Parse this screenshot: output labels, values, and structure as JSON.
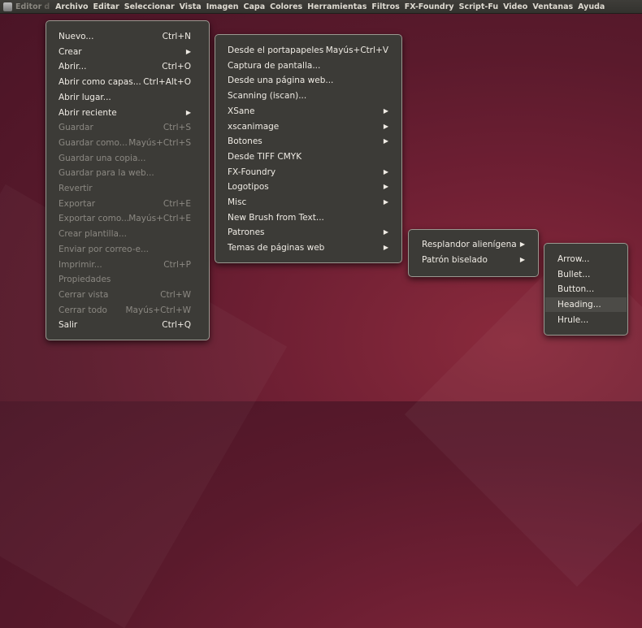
{
  "menubar": {
    "app_title": "Editor",
    "sep": "d",
    "items": [
      "Archivo",
      "Editar",
      "Seleccionar",
      "Vista",
      "Imagen",
      "Capa",
      "Colores",
      "Herramientas",
      "Filtros",
      "FX-Foundry",
      "Script-Fu",
      "Video",
      "Ventanas",
      "Ayuda"
    ]
  },
  "archivo_menu": [
    {
      "label": "Nuevo...",
      "acc": "Ctrl+N",
      "enabled": true
    },
    {
      "label": "Crear",
      "acc": "",
      "submenu": true,
      "enabled": true
    },
    {
      "label": "Abrir...",
      "acc": "Ctrl+O",
      "enabled": true
    },
    {
      "label": "Abrir como capas...",
      "acc": "Ctrl+Alt+O",
      "enabled": true
    },
    {
      "label": "Abrir lugar...",
      "acc": "",
      "enabled": true
    },
    {
      "label": "Abrir reciente",
      "acc": "",
      "submenu": true,
      "enabled": true
    },
    {
      "label": "Guardar",
      "acc": "Ctrl+S",
      "enabled": false
    },
    {
      "label": "Guardar como...",
      "acc": "Mayús+Ctrl+S",
      "enabled": false
    },
    {
      "label": "Guardar una copia...",
      "acc": "",
      "enabled": false
    },
    {
      "label": "Guardar para la web...",
      "acc": "",
      "enabled": false
    },
    {
      "label": "Revertir",
      "acc": "",
      "enabled": false
    },
    {
      "label": "Exportar",
      "acc": "Ctrl+E",
      "enabled": false
    },
    {
      "label": "Exportar como...",
      "acc": "Mayús+Ctrl+E",
      "enabled": false
    },
    {
      "label": "Crear plantilla...",
      "acc": "",
      "enabled": false
    },
    {
      "label": "Enviar por correo-e...",
      "acc": "",
      "enabled": false
    },
    {
      "label": "Imprimir...",
      "acc": "Ctrl+P",
      "enabled": false
    },
    {
      "label": "Propiedades",
      "acc": "",
      "enabled": false
    },
    {
      "label": "Cerrar vista",
      "acc": "Ctrl+W",
      "enabled": false
    },
    {
      "label": "Cerrar todo",
      "acc": "Mayús+Ctrl+W",
      "enabled": false
    },
    {
      "label": "Salir",
      "acc": "Ctrl+Q",
      "enabled": true
    }
  ],
  "crear_menu": [
    {
      "label": "Desde el portapapeles",
      "acc": "Mayús+Ctrl+V"
    },
    {
      "label": "Captura de pantalla...",
      "acc": ""
    },
    {
      "label": "Desde una página web...",
      "acc": ""
    },
    {
      "label": "Scanning (iscan)...",
      "acc": ""
    },
    {
      "label": "XSane",
      "acc": "",
      "submenu": true
    },
    {
      "label": "xscanimage",
      "acc": "",
      "submenu": true
    },
    {
      "label": "Botones",
      "acc": "",
      "submenu": true
    },
    {
      "label": "Desde TIFF CMYK",
      "acc": ""
    },
    {
      "label": "FX-Foundry",
      "acc": "",
      "submenu": true
    },
    {
      "label": "Logotipos",
      "acc": "",
      "submenu": true
    },
    {
      "label": "Misc",
      "acc": "",
      "submenu": true
    },
    {
      "label": "New Brush from Text...",
      "acc": ""
    },
    {
      "label": "Patrones",
      "acc": "",
      "submenu": true
    },
    {
      "label": "Temas de páginas web",
      "acc": "",
      "submenu": true
    }
  ],
  "temas_menu": [
    {
      "label": "Resplandor alienígena",
      "submenu": true
    },
    {
      "label": "Patrón biselado",
      "submenu": true
    }
  ],
  "patron_menu": [
    {
      "label": "Arrow..."
    },
    {
      "label": "Bullet..."
    },
    {
      "label": "Button..."
    },
    {
      "label": "Heading...",
      "highlighted": true
    },
    {
      "label": "Hrule..."
    }
  ],
  "submenu_arrow": "▶"
}
